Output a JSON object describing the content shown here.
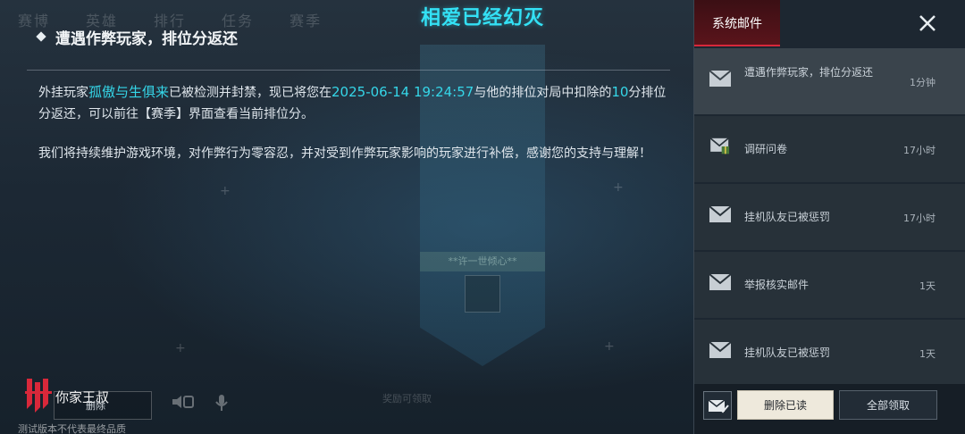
{
  "background": {
    "tabs": [
      "赛博",
      "英雄",
      "排行",
      "任务",
      "赛季"
    ],
    "banner_label": "**许一世倾心**",
    "bottom_hint": "奖励可领取"
  },
  "header": {
    "title": "相爱已经幻灭"
  },
  "mail": {
    "title": "遭遇作弊玩家，排位分返还",
    "body_p1_a": "外挂玩家",
    "body_p1_player": "孤傲与生俱来",
    "body_p1_b": "已被检测并封禁，现已将您在",
    "body_p1_time": "2025-06-14 19:24:57",
    "body_p1_c": "与他的排位对局中扣除的",
    "body_p1_points": "10",
    "body_p1_d": "分排位分返还，可以前往【赛季】界面查看当前排位分。",
    "body_p2": "我们将持续维护游戏环境，对作弊行为零容忍，并对受到作弊玩家影响的玩家进行补偿，感谢您的支持与理解！"
  },
  "bottom_left": {
    "brand_name": "你家王叔",
    "delete_label": "删除",
    "footer_note": "测试版本不代表最终品质"
  },
  "panel": {
    "tab_label": "系统邮件",
    "close_icon": "close-icon",
    "items": [
      {
        "title": "遭遇作弊玩家，排位分返还",
        "time": "1分钟"
      },
      {
        "title": "调研问卷",
        "time": "17小时"
      },
      {
        "title": "挂机队友已被惩罚",
        "time": "17小时"
      },
      {
        "title": "举报核实邮件",
        "time": "1天"
      },
      {
        "title": "挂机队友已被惩罚",
        "time": "1天"
      }
    ],
    "delete_read_label": "删除已读",
    "claim_all_label": "全部领取"
  },
  "colors": {
    "highlight": "#35d6e8",
    "title_cyan": "#33e1f5",
    "tab_red": "#d8283a"
  }
}
